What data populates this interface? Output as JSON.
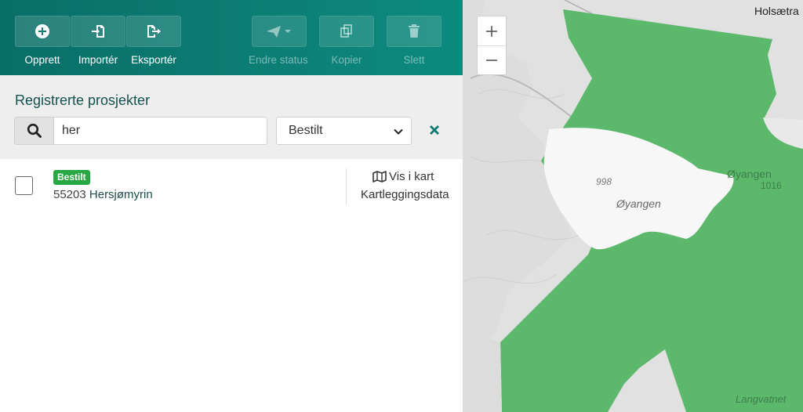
{
  "toolbar": {
    "create": "Opprett",
    "import": "Importér",
    "export": "Eksportér",
    "change_status": "Endre status",
    "copy": "Kopier",
    "delete": "Slett"
  },
  "filter": {
    "title": "Registrerte prosjekter",
    "search_value": "her",
    "status_selected": "Bestilt"
  },
  "projects": [
    {
      "status": "Bestilt",
      "number": "55203",
      "name": "Hersjømyrin",
      "map_link": "Vis i kart",
      "data_link": "Kartleggingsdata"
    }
  ],
  "map": {
    "zoom_in": "+",
    "zoom_out": "−",
    "labels": {
      "holsaetra": "Holsætra",
      "oyangen_lake": "Øyangen",
      "oyangen_area": "Øyangen",
      "elev_998": "998",
      "elev_1016": "1016",
      "langvatnet": "Langvatnet"
    },
    "colors": {
      "polygon": "#5cb96b",
      "lake": "#f7f7f7",
      "terrain": "#e1e1e1"
    }
  },
  "colors": {
    "toolbar": "#0d7f76",
    "badge": "#28a745",
    "title": "#14524d"
  }
}
